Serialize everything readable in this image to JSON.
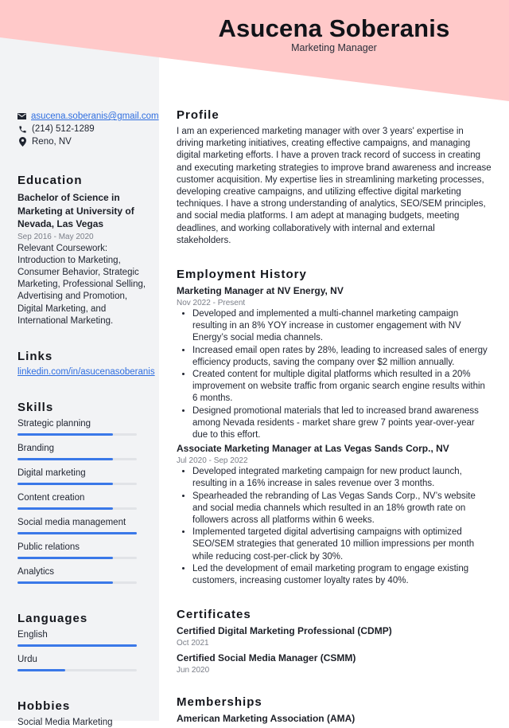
{
  "header": {
    "name": "Asucena Soberanis",
    "title": "Marketing Manager",
    "accent_color": "#ffc9c9"
  },
  "contact": {
    "email": "asucena.soberanis@gmail.com",
    "phone": "(214) 512-1289",
    "location": "Reno, NV",
    "icons": [
      "envelope-icon",
      "phone-icon",
      "map-pin-icon"
    ]
  },
  "education": {
    "heading": "Education",
    "degree": "Bachelor of Science in Marketing at University of Nevada, Las Vegas",
    "dates": "Sep 2016 - May 2020",
    "description": "Relevant Coursework: Introduction to Marketing, Consumer Behavior, Strategic Marketing, Professional Selling, Advertising and Promotion, Digital Marketing, and International Marketing."
  },
  "links": {
    "heading": "Links",
    "items": [
      "linkedin.com/in/asucenasoberanis"
    ]
  },
  "skills": {
    "heading": "Skills",
    "bar_color": "#3a78e8",
    "items": [
      {
        "label": "Strategic planning",
        "level": 0.8
      },
      {
        "label": "Branding",
        "level": 0.8
      },
      {
        "label": "Digital marketing",
        "level": 0.8
      },
      {
        "label": "Content creation",
        "level": 0.8
      },
      {
        "label": "Social media management",
        "level": 1.0
      },
      {
        "label": "Public relations",
        "level": 0.8
      },
      {
        "label": "Analytics",
        "level": 0.8
      }
    ]
  },
  "languages": {
    "heading": "Languages",
    "items": [
      {
        "label": "English",
        "level": 1.0
      },
      {
        "label": "Urdu",
        "level": 0.4
      }
    ]
  },
  "hobbies": {
    "heading": "Hobbies",
    "items": [
      "Social Media Marketing"
    ]
  },
  "profile": {
    "heading": "Profile",
    "text": "I am an experienced marketing manager with over 3 years' expertise in driving marketing initiatives, creating effective campaigns, and managing digital marketing efforts. I have a proven track record of success in creating and executing marketing strategies to improve brand awareness and increase customer acquisition. My expertise lies in streamlining marketing processes, developing creative campaigns, and utilizing effective digital marketing techniques. I have a strong understanding of analytics, SEO/SEM principles, and social media platforms. I am adept at managing budgets, meeting deadlines, and working collaboratively with internal and external stakeholders."
  },
  "employment": {
    "heading": "Employment History",
    "jobs": [
      {
        "title": "Marketing Manager at NV Energy, NV",
        "dates": "Nov 2022 - Present",
        "bullets": [
          "Developed and implemented a multi-channel marketing campaign resulting in an 8% YOY increase in customer engagement with NV Energy’s social media channels.",
          "Increased email open rates by 28%, leading to increased sales of energy efficiency products, saving the company over $2 million annually.",
          "Created content for multiple digital platforms which resulted in a 20% improvement on website traffic from organic search engine results within 6 months.",
          "Designed promotional materials that led to increased brand awareness among Nevada residents - market share grew 7 points year-over-year due to this effort."
        ]
      },
      {
        "title": "Associate Marketing Manager at Las Vegas Sands Corp., NV",
        "dates": "Jul 2020 - Sep 2022",
        "bullets": [
          "Developed integrated marketing campaign for new product launch, resulting in a 16% increase in sales revenue over 3 months.",
          "Spearheaded the rebranding of Las Vegas Sands Corp., NV’s website and social media channels which resulted in an 18% growth rate on followers across all platforms within 6 weeks.",
          "Implemented targeted digital advertising campaigns with optimized SEO/SEM strategies that generated 10 million impressions per month while reducing cost-per-click by 30%.",
          "Led the development of email marketing program to engage existing customers, increasing customer loyalty rates by 40%."
        ]
      }
    ]
  },
  "certificates": {
    "heading": "Certificates",
    "items": [
      {
        "title": "Certified Digital Marketing Professional (CDMP)",
        "date": "Oct 2021"
      },
      {
        "title": "Certified Social Media Manager (CSMM)",
        "date": "Jun 2020"
      }
    ]
  },
  "memberships": {
    "heading": "Memberships",
    "items": [
      "American Marketing Association (AMA)"
    ]
  }
}
